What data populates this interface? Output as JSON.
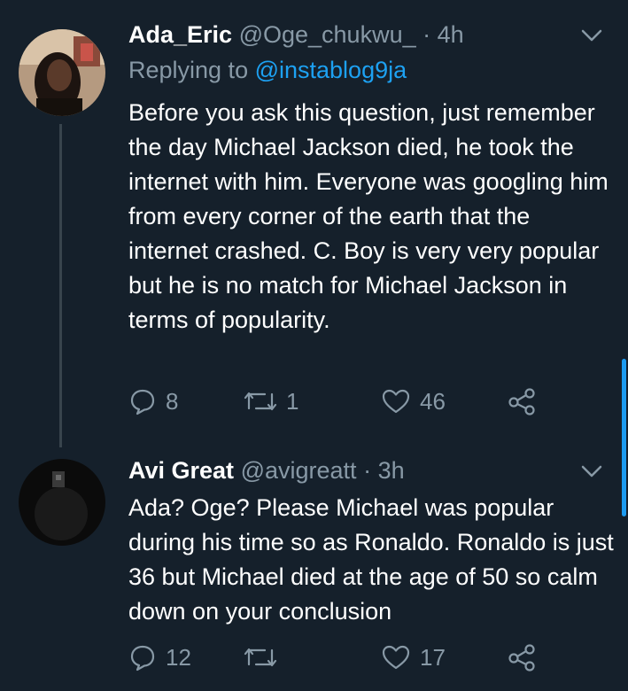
{
  "tweets": [
    {
      "name": "Ada_Eric",
      "handle": "@Oge_chukwu_",
      "dot": "·",
      "time": "4h",
      "replying_prefix": "Replying to ",
      "replying_to": "@instablog9ja",
      "text": "Before you ask this question, just remember the day Michael Jackson died, he took the internet with him. Everyone was googling him from every corner of the earth that the internet crashed. C. Boy is very very popular but he is no match for Michael Jackson in terms of popularity.",
      "reply_count": "8",
      "retweet_count": "1",
      "like_count": "46"
    },
    {
      "name": "Avi Great",
      "handle": "@avigreatt",
      "dot": "·",
      "time": "3h",
      "text": "Ada? Oge? Please Michael was popular during his time so as Ronaldo. Ronaldo is just 36 but Michael died at the age of 50 so calm down on your conclusion",
      "reply_count": "12",
      "retweet_count": "",
      "like_count": "17"
    }
  ],
  "icons": {
    "reply": "comment-icon",
    "retweet": "retweet-icon",
    "like": "heart-icon",
    "share": "share-icon",
    "menu": "chevron-down-icon"
  },
  "colors": {
    "background": "#15202b",
    "secondary_text": "#8899a6",
    "link": "#1da1f2",
    "thread_line": "#38444d"
  }
}
